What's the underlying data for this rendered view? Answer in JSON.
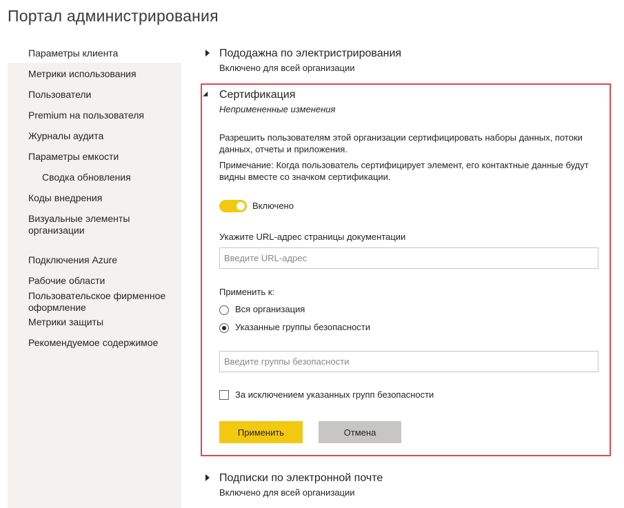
{
  "title": "Портал администрирования",
  "sidebar": {
    "items": [
      {
        "label": "Параметры клиента",
        "active": true
      },
      {
        "label": "Метрики использования"
      },
      {
        "label": "Пользователи"
      },
      {
        "label": "Premium на пользователя"
      },
      {
        "label": "Журналы аудита"
      },
      {
        "label": "Параметры емкости"
      },
      {
        "label": "Сводка обновления",
        "sub": true
      },
      {
        "label": "Коды внедрения"
      },
      {
        "label": "Визуальные элементы организации"
      },
      {
        "label": "Подключения Azure"
      },
      {
        "label": "Рабочие области"
      },
      {
        "label": "Пользовательское фирменное оформление"
      },
      {
        "label": "Метрики защиты"
      },
      {
        "label": "Рекомендуемое содержимое"
      }
    ]
  },
  "sections": {
    "first": {
      "title": "Пододажна по электристрирования",
      "status": "Включено для всей организации"
    },
    "certification": {
      "title": "Сертификация",
      "status": "Непримененные изменения",
      "description": "Разрешить пользователям этой организации сертифицировать наборы данных, потоки данных, отчеты и приложения.",
      "note": "Примечание: Когда пользователь сертифицирует элемент, его контактные данные будут видны вместе со значком сертификации.",
      "toggle_label": "Включено",
      "toggle_on": true,
      "url_label": "Укажите URL-адрес страницы документации",
      "url_placeholder": "Введите URL-адрес",
      "apply_to_label": "Применить к:",
      "radio_all": "Вся организация",
      "radio_groups": "Указанные группы безопасности",
      "groups_placeholder": "Введите группы безопасности",
      "exclude_label": "За исключением указанных групп безопасности",
      "apply_button": "Применить",
      "cancel_button": "Отмена"
    },
    "last": {
      "title": "Подписки по электронной почте",
      "status": "Включено для всей организации"
    }
  },
  "colors": {
    "accent": "#f2c811",
    "highlight_border": "#e0474c"
  }
}
